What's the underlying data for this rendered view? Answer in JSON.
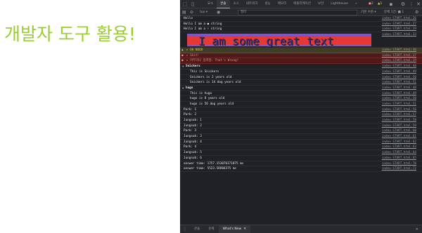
{
  "page": {
    "title": "개발자 도구 활용!"
  },
  "devtools": {
    "tabs": [
      {
        "label": "요소",
        "active": false
      },
      {
        "label": "콘솔",
        "active": true
      },
      {
        "label": "소스",
        "active": false
      },
      {
        "label": "네트워크",
        "active": false
      },
      {
        "label": "성능",
        "active": false
      },
      {
        "label": "메모리",
        "active": false
      },
      {
        "label": "애플리케이션",
        "active": false
      },
      {
        "label": "보안",
        "active": false
      },
      {
        "label": "Lighthouse",
        "active": false
      },
      {
        "label": "»",
        "active": false
      }
    ],
    "error_count": "2",
    "warning_count": "1",
    "toolbar": {
      "context": "top ▾",
      "filter_placeholder": "필터",
      "levels": "기본 수준 ▾",
      "issues": "문제 1건: ■ 1"
    },
    "console": {
      "styled_text": "I am some great text",
      "rows": [
        {
          "type": "log",
          "msg": "Hello",
          "src": "index-START.html:26"
        },
        {
          "type": "log",
          "msg": "Hello I am a ● string",
          "src": "index-START.html:27"
        },
        {
          "type": "log",
          "msg": "Hello I am a ⚐ string",
          "src": "index-START.html:29"
        },
        {
          "type": "styled",
          "src": "index-START.html:33"
        },
        {
          "type": "warn",
          "msg": "▸ OH NOOO",
          "src": "index-START.html:36"
        },
        {
          "type": "error",
          "msg": "▸ Shit!",
          "src": "index-START.html:37"
        },
        {
          "type": "error",
          "msg": "▸ 아무거나 입력함: That's Wrong!",
          "src": "index-START.html:39"
        },
        {
          "type": "group",
          "msg": "Snickers",
          "src": "index-START.html:48"
        },
        {
          "type": "indent",
          "msg": "This is Snickers",
          "src": "index-START.html:49"
        },
        {
          "type": "indent",
          "msg": "Snickers is 2 years old",
          "src": "index-START.html:50"
        },
        {
          "type": "indent",
          "msg": "Snickers is 14 dog years old",
          "src": "index-START.html:51"
        },
        {
          "type": "group",
          "msg": "hugo",
          "src": "index-START.html:48"
        },
        {
          "type": "indent",
          "msg": "This is hugo",
          "src": "index-START.html:49"
        },
        {
          "type": "indent",
          "msg": "hugo is 8 years old",
          "src": "index-START.html:50"
        },
        {
          "type": "indent",
          "msg": "hugo is 56 dog years old",
          "src": "index-START.html:51"
        },
        {
          "type": "log",
          "msg": "Park: 1",
          "src": "index-START.html:56"
        },
        {
          "type": "log",
          "msg": "Park: 2",
          "src": "index-START.html:57"
        },
        {
          "type": "log",
          "msg": "Jungsub: 1",
          "src": "index-START.html:58"
        },
        {
          "type": "log",
          "msg": "Jungsub: 2",
          "src": "index-START.html:59"
        },
        {
          "type": "log",
          "msg": "Park: 3",
          "src": "index-START.html:60"
        },
        {
          "type": "log",
          "msg": "Jungsub: 3",
          "src": "index-START.html:61"
        },
        {
          "type": "log",
          "msg": "Jungsub: 4",
          "src": "index-START.html:62"
        },
        {
          "type": "log",
          "msg": "Park: 4",
          "src": "index-START.html:63"
        },
        {
          "type": "log",
          "msg": "Jungsub: 5",
          "src": "index-START.html:64"
        },
        {
          "type": "log",
          "msg": "Jungsub: 6",
          "src": "index-START.html:65"
        },
        {
          "type": "log",
          "msg": "answer time: 1757.153076171875 ms",
          "src": "index-START.html:70"
        },
        {
          "type": "log",
          "msg": "answer time: 5523.58984375 ms",
          "src": "index-START.html:72"
        }
      ]
    },
    "drawer": {
      "tabs": [
        {
          "label": "콘솔",
          "active": false,
          "closable": false
        },
        {
          "label": "문제",
          "active": false,
          "closable": false
        },
        {
          "label": "What's New",
          "active": true,
          "closable": true
        }
      ]
    }
  }
}
